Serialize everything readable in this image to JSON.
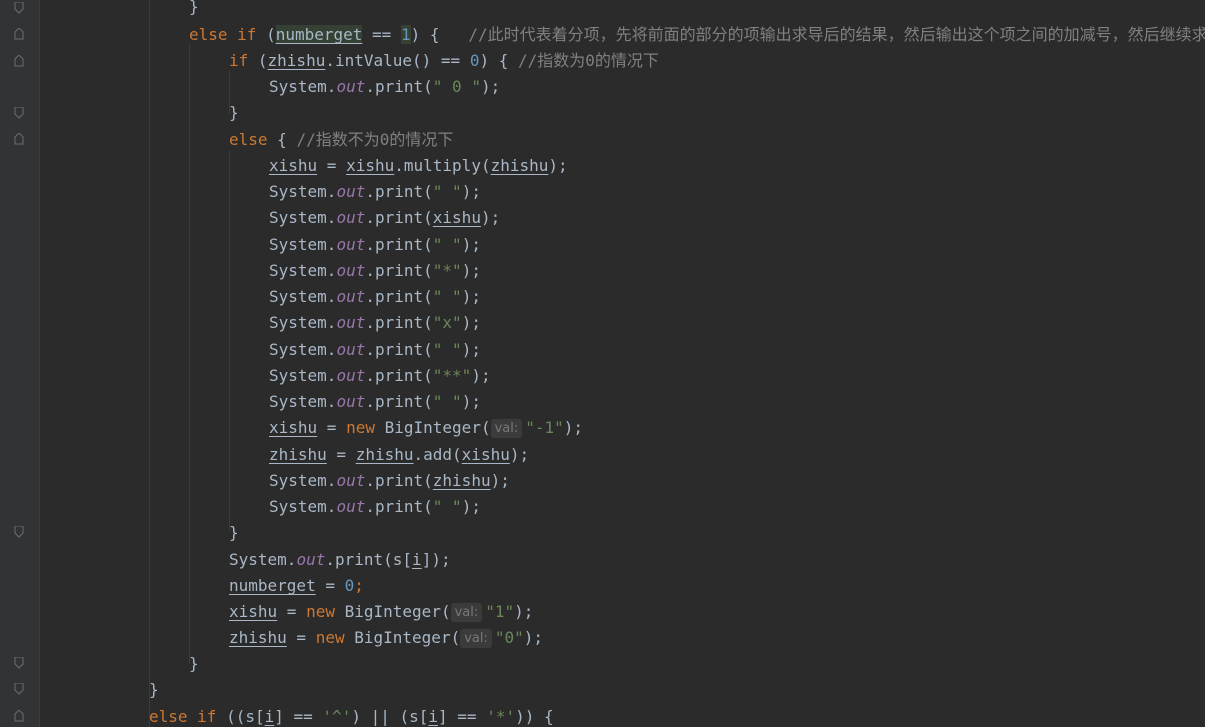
{
  "theme": {
    "background": "#2b2b2b",
    "gutter": "#313335",
    "keyword": "#cc7832",
    "number": "#6897bb",
    "string": "#6a8759",
    "comment": "#808080",
    "field": "#9876aa",
    "text": "#a9b7c6"
  },
  "gutter": {
    "fold_icons": [
      "fold-icon",
      "fold-icon",
      "fold-icon",
      "fold-icon",
      "fold-icon",
      "fold-icon",
      "fold-icon",
      "fold-icon",
      "fold-icon",
      "fold-icon"
    ]
  },
  "code": {
    "l0": {
      "t1": "}"
    },
    "l1": {
      "kw_else": "else",
      "kw_if": "if",
      "p1": " (",
      "var": "numberget",
      "op": " == ",
      "num": "1",
      "p2": ") {   ",
      "cmt": "//此时代表着分项，先将前面的部分的项输出求导后的结果，然后输出这个项之间的加减号，然后继续求导"
    },
    "l2": {
      "kw_if": "if",
      "p1": " (",
      "var": "zhishu",
      "m1": ".intValue() == ",
      "num": "0",
      "p2": ") { ",
      "cmt": "//指数为0的情况下"
    },
    "l3": {
      "cls": "System.",
      "fld": "out",
      "m": ".print(",
      "str": "\" 0 \"",
      "end": ");"
    },
    "l4": {
      "t1": "}"
    },
    "l5": {
      "kw_else": "else",
      "p1": " { ",
      "cmt": "//指数不为0的情况下"
    },
    "l6": {
      "var1": "xishu",
      "op": " = ",
      "var2": "xishu",
      "m": ".multiply(",
      "var3": "zhishu",
      "end": ");"
    },
    "l7": {
      "cls": "System.",
      "fld": "out",
      "m": ".print(",
      "str": "\" \"",
      "end": ");"
    },
    "l8": {
      "cls": "System.",
      "fld": "out",
      "m": ".print(",
      "var": "xishu",
      "end": ");"
    },
    "l9": {
      "cls": "System.",
      "fld": "out",
      "m": ".print(",
      "str": "\" \"",
      "end": ");"
    },
    "l10": {
      "cls": "System.",
      "fld": "out",
      "m": ".print(",
      "str": "\"*\"",
      "end": ");"
    },
    "l11": {
      "cls": "System.",
      "fld": "out",
      "m": ".print(",
      "str": "\" \"",
      "end": ");"
    },
    "l12": {
      "cls": "System.",
      "fld": "out",
      "m": ".print(",
      "str": "\"x\"",
      "end": ");"
    },
    "l13": {
      "cls": "System.",
      "fld": "out",
      "m": ".print(",
      "str": "\" \"",
      "end": ");"
    },
    "l14": {
      "cls": "System.",
      "fld": "out",
      "m": ".print(",
      "str": "\"**\"",
      "end": ");"
    },
    "l15": {
      "cls": "System.",
      "fld": "out",
      "m": ".print(",
      "str": "\" \"",
      "end": ");"
    },
    "l16": {
      "var": "xishu",
      "op": " = ",
      "kw_new": "new",
      "cls": " BigInteger(",
      "hint": "val:",
      "str": "\"-1\"",
      "end": ");"
    },
    "l17": {
      "var1": "zhishu",
      "op": " = ",
      "var2": "zhishu",
      "m": ".add(",
      "var3": "xishu",
      "end": ");"
    },
    "l18": {
      "cls": "System.",
      "fld": "out",
      "m": ".print(",
      "var": "zhishu",
      "end": ");"
    },
    "l19": {
      "cls": "System.",
      "fld": "out",
      "m": ".print(",
      "str": "\" \"",
      "end": ");"
    },
    "l20": {
      "t1": "}"
    },
    "l21": {
      "cls": "System.",
      "fld": "out",
      "m": ".print(s[",
      "var": "i",
      "end": "]);"
    },
    "l22": {
      "var": "numberget",
      "op": " = ",
      "num": "0",
      "end": ";"
    },
    "l23": {
      "var": "xishu",
      "op": " = ",
      "kw_new": "new",
      "cls": " BigInteger(",
      "hint": "val:",
      "str": "\"1\"",
      "end": ");"
    },
    "l24": {
      "var": "zhishu",
      "op": " = ",
      "kw_new": "new",
      "cls": " BigInteger(",
      "hint": "val:",
      "str": "\"0\"",
      "end": ");"
    },
    "l25": {
      "t1": "}"
    },
    "l26": {
      "t1": "}"
    },
    "l27": {
      "kw_else": "else",
      "kw_if": "if",
      "p1": " ((s[",
      "var1": "i",
      "p2": "] == ",
      "str1": "'^'",
      "p3": ") || (s[",
      "var2": "i",
      "p4": "] == ",
      "str2": "'*'",
      "p5": ")) {"
    }
  }
}
